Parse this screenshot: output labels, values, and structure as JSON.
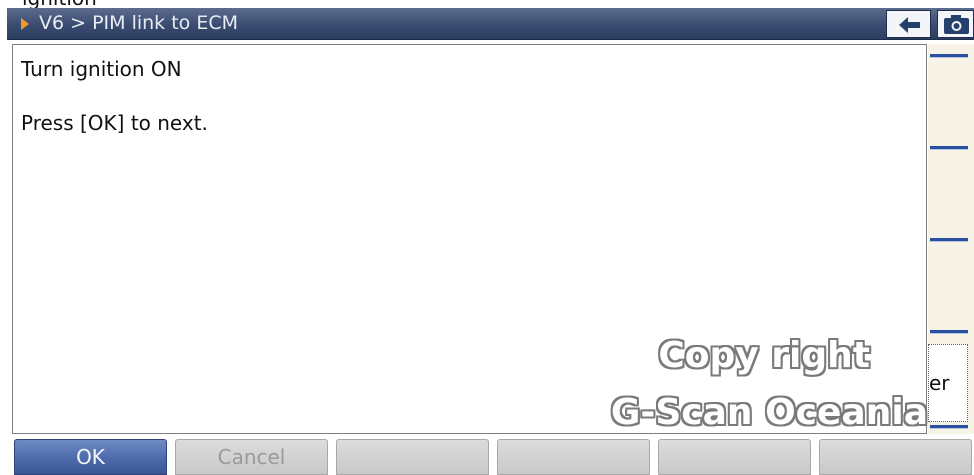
{
  "top_caption": "ignition",
  "header": {
    "title": "V6 > PIM link to ECM",
    "back_icon": "back-arrow-icon",
    "camera_icon": "camera-icon",
    "title_bar_color": "#3a4c70",
    "accent_arrow_color": "#f39a2a"
  },
  "content": {
    "lines": [
      "Turn ignition ON",
      "Press [OK] to next."
    ]
  },
  "side_panel": {
    "button_label": "er"
  },
  "watermark": {
    "line1": "Copy right",
    "line2": "G-Scan Oceania"
  },
  "footer": {
    "buttons": [
      {
        "label": "OK"
      },
      {
        "label": "Cancel"
      },
      {
        "label": ""
      },
      {
        "label": ""
      },
      {
        "label": ""
      },
      {
        "label": ""
      }
    ]
  }
}
